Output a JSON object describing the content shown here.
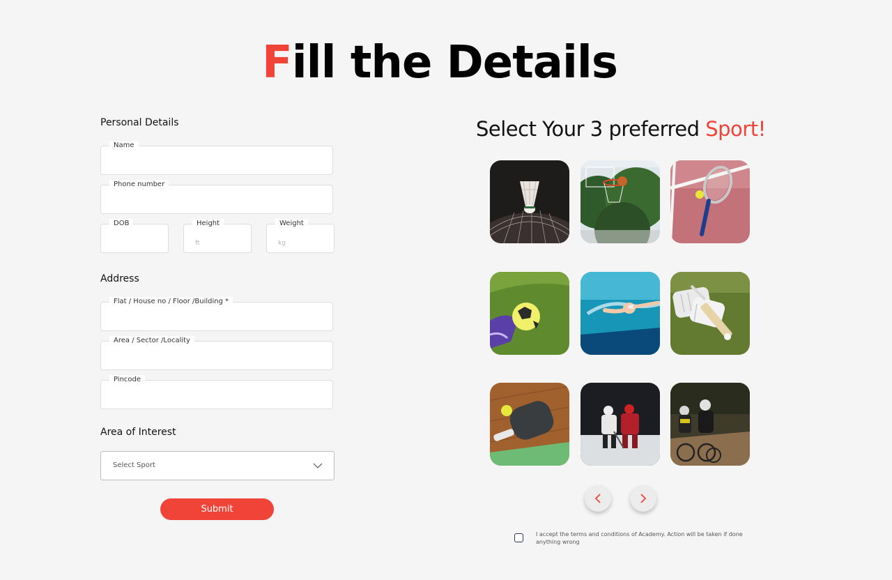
{
  "page": {
    "title_first_letter": "F",
    "title_rest": "ill the Details"
  },
  "personal": {
    "heading": "Personal Details",
    "name_label": "Name",
    "phone_label": "Phone number",
    "dob_label": "DOB",
    "height_label": "Height",
    "height_placeholder": "ft",
    "weight_label": "Weight",
    "weight_placeholder": "kg"
  },
  "address": {
    "heading": "Address",
    "flat_label": "Flat / House no / Floor /Building *",
    "area_label": "Area / Sector /Locality",
    "pincode_label": "Pincode"
  },
  "interest": {
    "heading": "Area of Interest",
    "select_value": "Select Sport"
  },
  "submit_label": "Submit",
  "sports": {
    "title_main": "Select Your 3 preferred ",
    "title_accent": "Sport!",
    "tiles": [
      {
        "icon": "badminton-shuttlecock-icon"
      },
      {
        "icon": "basketball-hoop-icon"
      },
      {
        "icon": "tennis-racket-icon"
      },
      {
        "icon": "football-icon"
      },
      {
        "icon": "swimming-icon"
      },
      {
        "icon": "cricket-gear-icon"
      },
      {
        "icon": "pickleball-paddle-icon"
      },
      {
        "icon": "ice-hockey-icon"
      },
      {
        "icon": "cycling-icon"
      }
    ]
  },
  "carousel": {
    "prev_icon": "chevron-left-icon",
    "next_icon": "chevron-right-icon"
  },
  "terms_text": "I accept the terms and conditions of Academy. Action will be taken if done anything wrong",
  "colors": {
    "accent": "#f04438",
    "background": "#f5f5f5"
  }
}
